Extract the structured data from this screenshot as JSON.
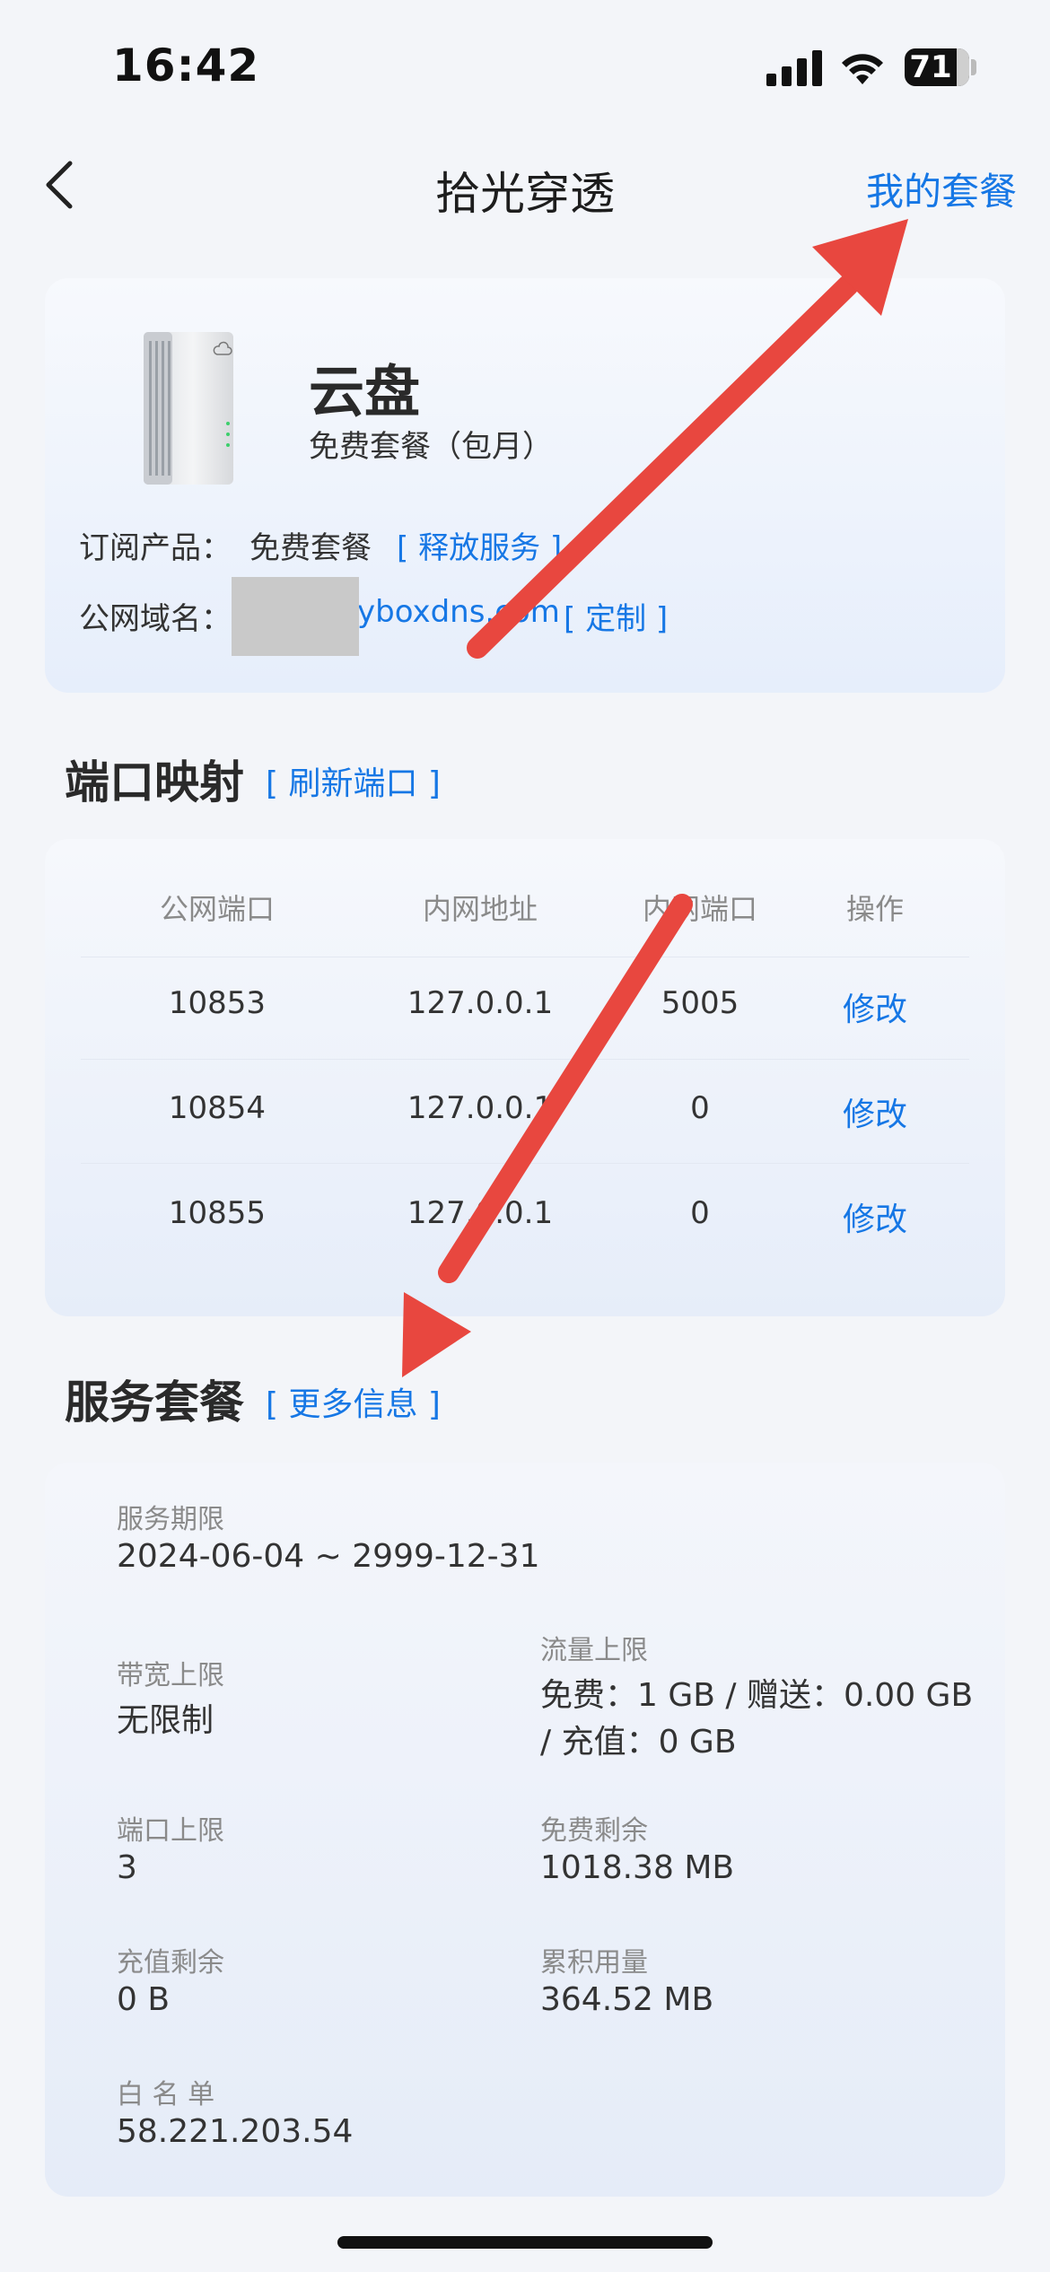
{
  "status_bar": {
    "time": "16:42",
    "battery": "71"
  },
  "nav": {
    "title": "拾光穿透",
    "right_link": "我的套餐"
  },
  "product": {
    "name": "云盘",
    "plan": "免费套餐（包月）",
    "subscription_label": "订阅产品：",
    "subscription_value": "免费套餐",
    "subscription_link": "[ 释放服务 ]",
    "domain_label": "公网域名：",
    "domain_value": "yboxdns.com",
    "domain_link": "[ 定制 ]"
  },
  "port_mapping": {
    "title": "端口映射",
    "refresh_link": "[ 刷新端口 ]",
    "headers": [
      "公网端口",
      "内网地址",
      "内网端口",
      "操作"
    ],
    "rows": [
      {
        "public_port": "10853",
        "address": "127.0.0.1",
        "private_port": "5005",
        "action": "修改"
      },
      {
        "public_port": "10854",
        "address": "127.0.0.1",
        "private_port": "0",
        "action": "修改"
      },
      {
        "public_port": "10855",
        "address": "127.0.0.1",
        "private_port": "0",
        "action": "修改"
      }
    ]
  },
  "service": {
    "title": "服务套餐",
    "more_link": "[ 更多信息 ]",
    "term_label": "服务期限",
    "term_value": "2024-06-04 ~ 2999-12-31",
    "bandwidth_label": "带宽上限",
    "bandwidth_value": "无限制",
    "traffic_label": "流量上限",
    "traffic_value_line1": "免费：1 GB / 赠送：0.00 GB",
    "traffic_value_line2": "/ 充值：0 GB",
    "port_limit_label": "端口上限",
    "port_limit_value": "3",
    "free_remaining_label": "免费剩余",
    "free_remaining_value": "1018.38 MB",
    "recharge_remaining_label": "充值剩余",
    "recharge_remaining_value": "0 B",
    "total_usage_label": "累积用量",
    "total_usage_value": "364.52 MB",
    "whitelist_label": "白 名 单",
    "whitelist_value": "58.221.203.54"
  },
  "colors": {
    "accent": "#1677e5",
    "annotation_arrow": "#e8473f"
  }
}
